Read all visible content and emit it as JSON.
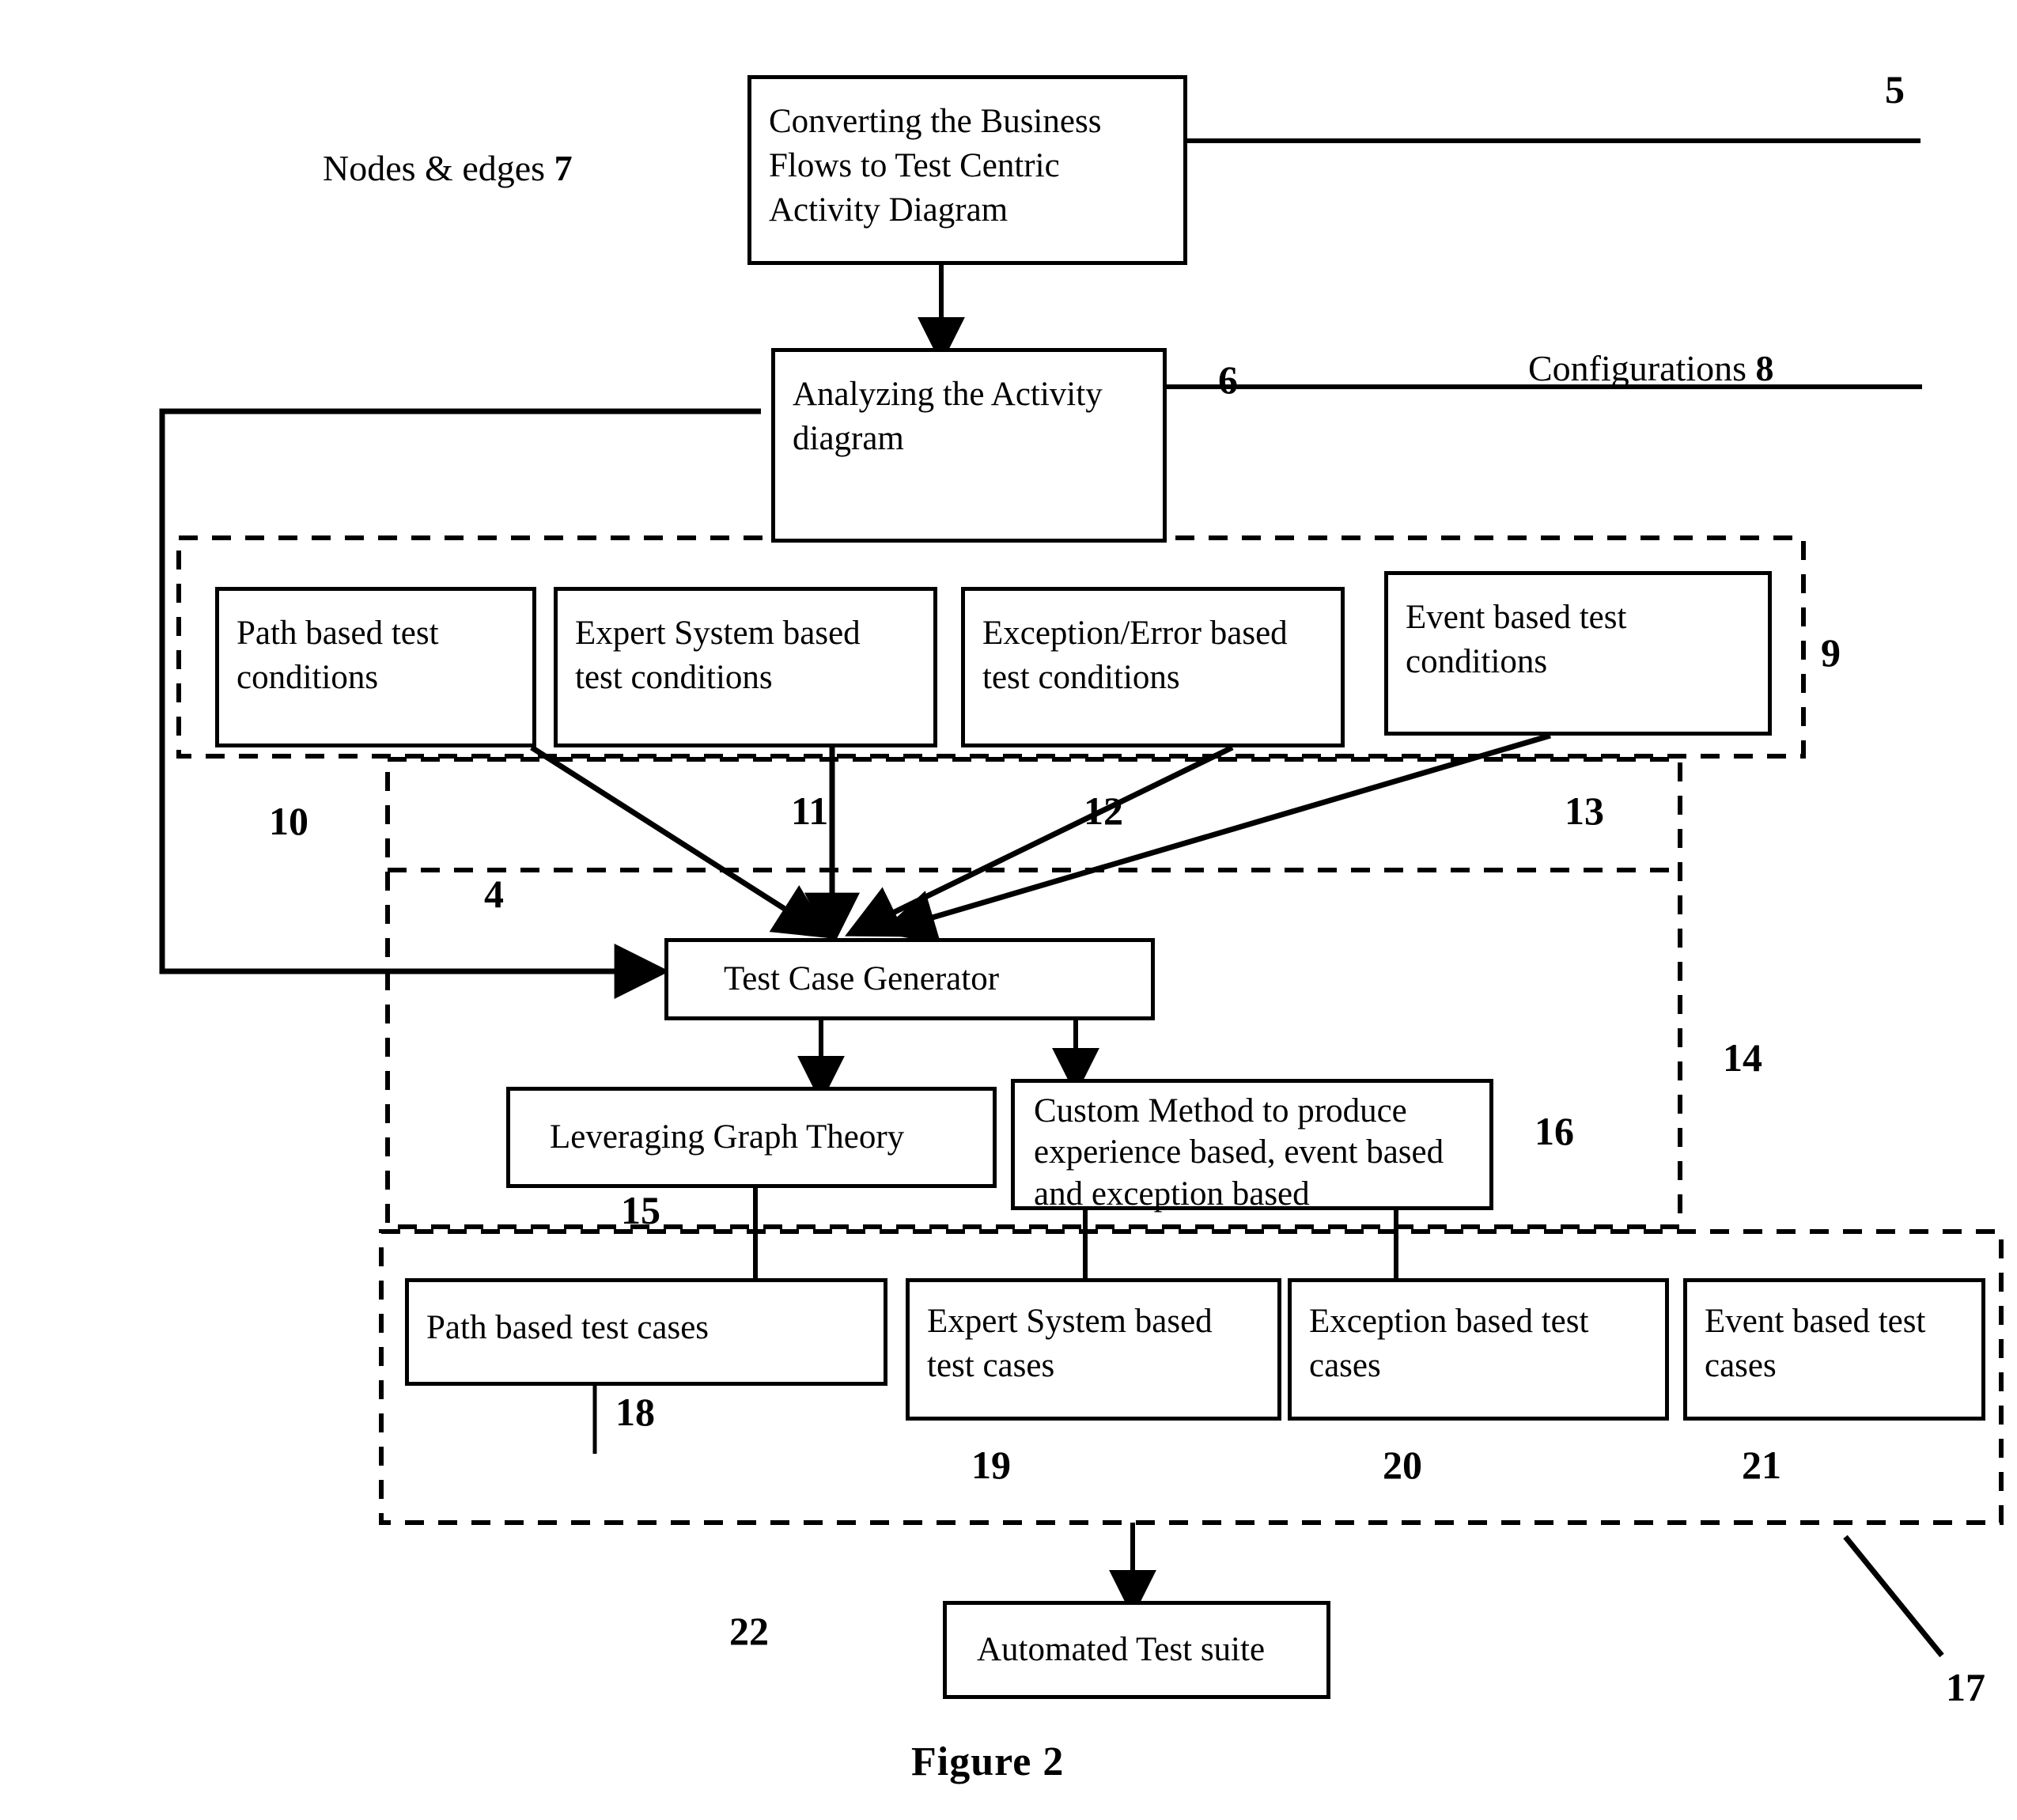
{
  "figure": {
    "caption": "Figure 2"
  },
  "labels": {
    "nodes_edges": "Nodes & edges",
    "nodes_edges_ref": "7",
    "configurations": "Configurations",
    "configurations_ref": "8"
  },
  "boxes": {
    "convert": "Converting the Business Flows to Test Centric Activity Diagram",
    "analyze": "Analyzing the Activity diagram",
    "cond_path": "Path based test conditions",
    "cond_expert": "Expert System based test conditions",
    "cond_exception": "Exception/Error based test conditions",
    "cond_event": "Event based test conditions",
    "generator": "Test Case Generator",
    "graph_theory": "Leveraging Graph Theory",
    "custom_method": "Custom Method to produce experience based, event based and exception based",
    "cases_path": "Path based test cases",
    "cases_expert": "Expert System based test cases",
    "cases_exception": "Exception based test cases",
    "cases_event": "Event based test cases",
    "suite": "Automated Test suite"
  },
  "refs": {
    "r4": "4",
    "r5": "5",
    "r6": "6",
    "r9": "9",
    "r10": "10",
    "r11": "11",
    "r12": "12",
    "r13": "13",
    "r14": "14",
    "r15": "15",
    "r16": "16",
    "r17": "17",
    "r18": "18",
    "r19": "19",
    "r20": "20",
    "r21": "21",
    "r22": "22"
  },
  "style": {
    "stroke": "#000000",
    "background": "#ffffff"
  }
}
